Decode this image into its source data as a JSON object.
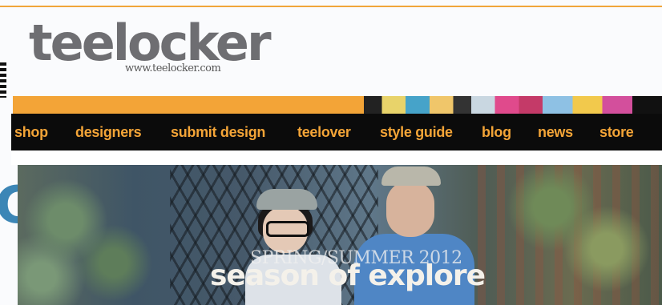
{
  "logo": {
    "text": "teelocker",
    "url_text": "www.teelocker.com"
  },
  "nav": {
    "items": [
      {
        "label": "shop"
      },
      {
        "label": "designers"
      },
      {
        "label": "submit design"
      },
      {
        "label": "teelover"
      },
      {
        "label": "style guide"
      },
      {
        "label": "blog"
      },
      {
        "label": "news"
      },
      {
        "label": "store"
      }
    ]
  },
  "hero": {
    "subtitle": "SPRING/SUMMER 2012",
    "title": "season of explore"
  },
  "colors": {
    "accent": "#f3a437",
    "nav_background": "#0b0b0b",
    "logo_gray": "#6e6e72"
  }
}
